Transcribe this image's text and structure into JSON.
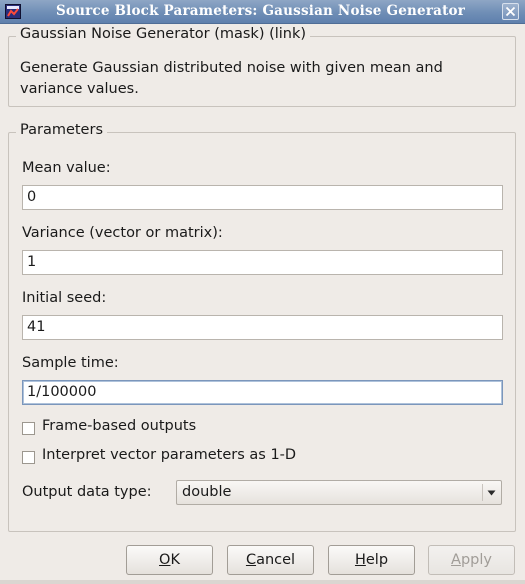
{
  "window": {
    "title": "Source Block Parameters: Gaussian Noise Generator"
  },
  "mask_group": {
    "title": "Gaussian Noise Generator (mask) (link)",
    "description": "Generate Gaussian distributed noise with given mean and variance values."
  },
  "parameters": {
    "title": "Parameters",
    "mean": {
      "label": "Mean value:",
      "value": "0"
    },
    "variance": {
      "label": "Variance (vector or matrix):",
      "value": "1"
    },
    "seed": {
      "label": "Initial seed:",
      "value": "41"
    },
    "sample_time": {
      "label": "Sample time:",
      "value": "1/100000"
    },
    "frame_based": {
      "label": "Frame-based outputs",
      "checked": false
    },
    "interpret_1d": {
      "label": "Interpret vector parameters as 1-D",
      "checked": false
    },
    "output_type": {
      "label": "Output data type:",
      "value": "double"
    }
  },
  "buttons": {
    "ok": {
      "mnemonic": "O",
      "rest": "K"
    },
    "cancel": {
      "mnemonic": "C",
      "rest": "ancel"
    },
    "help": {
      "mnemonic": "H",
      "rest": "elp"
    },
    "apply": {
      "mnemonic": "A",
      "rest": "pply",
      "disabled": true
    }
  },
  "icons": {
    "app": "simulink-window-icon",
    "close": "close-x-icon",
    "dropdown": "chevron-down-icon"
  },
  "colors": {
    "titlebar": "#6f8eb6",
    "background": "#efebe7",
    "focus_border": "#7b96bb"
  }
}
